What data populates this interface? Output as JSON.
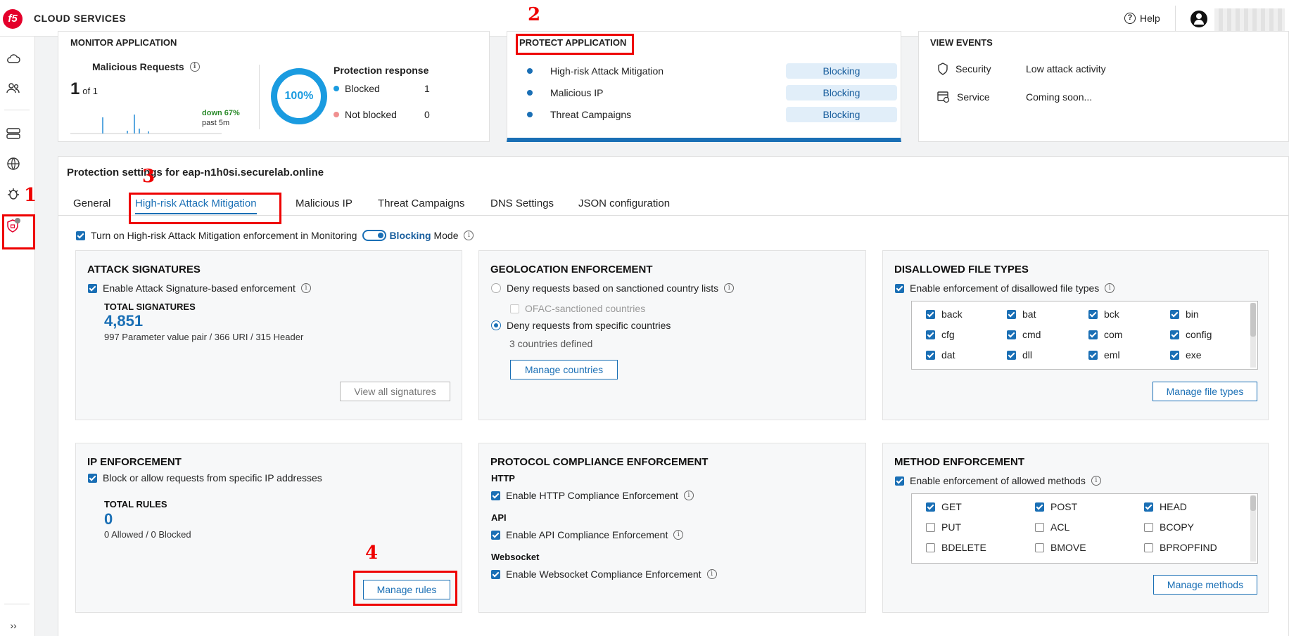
{
  "header": {
    "logo_text": "f5",
    "brand": "CLOUD SERVICES",
    "help": "Help"
  },
  "monitor": {
    "title": "MONITOR APPLICATION",
    "malicious_label": "Malicious Requests",
    "count": "1",
    "of": "of 1",
    "trend": "down 67%",
    "period": "past 5m",
    "percent": "100%",
    "protection_title": "Protection response",
    "blocked_label": "Blocked",
    "blocked_value": "1",
    "notblocked_label": "Not blocked",
    "notblocked_value": "0"
  },
  "protect": {
    "title": "PROTECT APPLICATION",
    "items": [
      {
        "label": "High-risk Attack Mitigation",
        "status": "Blocking"
      },
      {
        "label": "Malicious IP",
        "status": "Blocking"
      },
      {
        "label": "Threat Campaigns",
        "status": "Blocking"
      }
    ]
  },
  "events": {
    "title": "VIEW EVENTS",
    "security_label": "Security",
    "security_value": "Low attack activity",
    "service_label": "Service",
    "service_value": "Coming soon..."
  },
  "settings": {
    "title": "Protection settings for eap-n1h0si.securelab.online",
    "tabs": [
      "General",
      "High-risk Attack Mitigation",
      "Malicious IP",
      "Threat Campaigns",
      "DNS Settings",
      "JSON configuration"
    ],
    "mode_text": "Turn on High-risk Attack Mitigation enforcement in Monitoring",
    "mode_blocking": "Blocking",
    "mode_suffix": "Mode"
  },
  "attack_sig": {
    "title": "ATTACK SIGNATURES",
    "enable": "Enable Attack Signature-based enforcement",
    "total_label": "TOTAL SIGNATURES",
    "total": "4,851",
    "breakdown": "997 Parameter value pair / 366 URI / 315 Header",
    "button": "View all signatures"
  },
  "geo": {
    "title": "GEOLOCATION ENFORCEMENT",
    "opt1": "Deny requests based on sanctioned country lists",
    "ofac": "OFAC-sanctioned countries",
    "opt2": "Deny requests from specific countries",
    "defined": "3 countries defined",
    "button": "Manage countries"
  },
  "filetypes": {
    "title": "DISALLOWED FILE TYPES",
    "enable": "Enable enforcement of disallowed file types",
    "items": [
      "back",
      "bat",
      "bck",
      "bin",
      "cfg",
      "cmd",
      "com",
      "config",
      "dat",
      "dll",
      "eml",
      "exe"
    ],
    "button": "Manage file types"
  },
  "ip": {
    "title": "IP ENFORCEMENT",
    "enable": "Block or allow requests from specific IP addresses",
    "total_label": "TOTAL RULES",
    "total": "0",
    "breakdown": "0 Allowed / 0 Blocked",
    "button": "Manage rules"
  },
  "protocol": {
    "title": "PROTOCOL COMPLIANCE ENFORCEMENT",
    "http_head": "HTTP",
    "http": "Enable HTTP Compliance Enforcement",
    "api_head": "API",
    "api": "Enable API Compliance Enforcement",
    "ws_head": "Websocket",
    "ws": "Enable Websocket Compliance Enforcement"
  },
  "methods": {
    "title": "METHOD ENFORCEMENT",
    "enable": "Enable enforcement of allowed methods",
    "items": [
      {
        "label": "GET",
        "checked": true
      },
      {
        "label": "POST",
        "checked": true
      },
      {
        "label": "HEAD",
        "checked": true
      },
      {
        "label": "PUT",
        "checked": false
      },
      {
        "label": "ACL",
        "checked": false
      },
      {
        "label": "BCOPY",
        "checked": false
      },
      {
        "label": "BDELETE",
        "checked": false
      },
      {
        "label": "BMOVE",
        "checked": false
      },
      {
        "label": "BPROPFIND",
        "checked": false
      }
    ],
    "button": "Manage methods"
  },
  "annotations": [
    "1",
    "2",
    "3",
    "4"
  ],
  "colors": {
    "accent": "#1a6fb5",
    "annotation": "#ee0000",
    "blocked": "#1a9be0",
    "not_blocked": "#f08f8f"
  }
}
